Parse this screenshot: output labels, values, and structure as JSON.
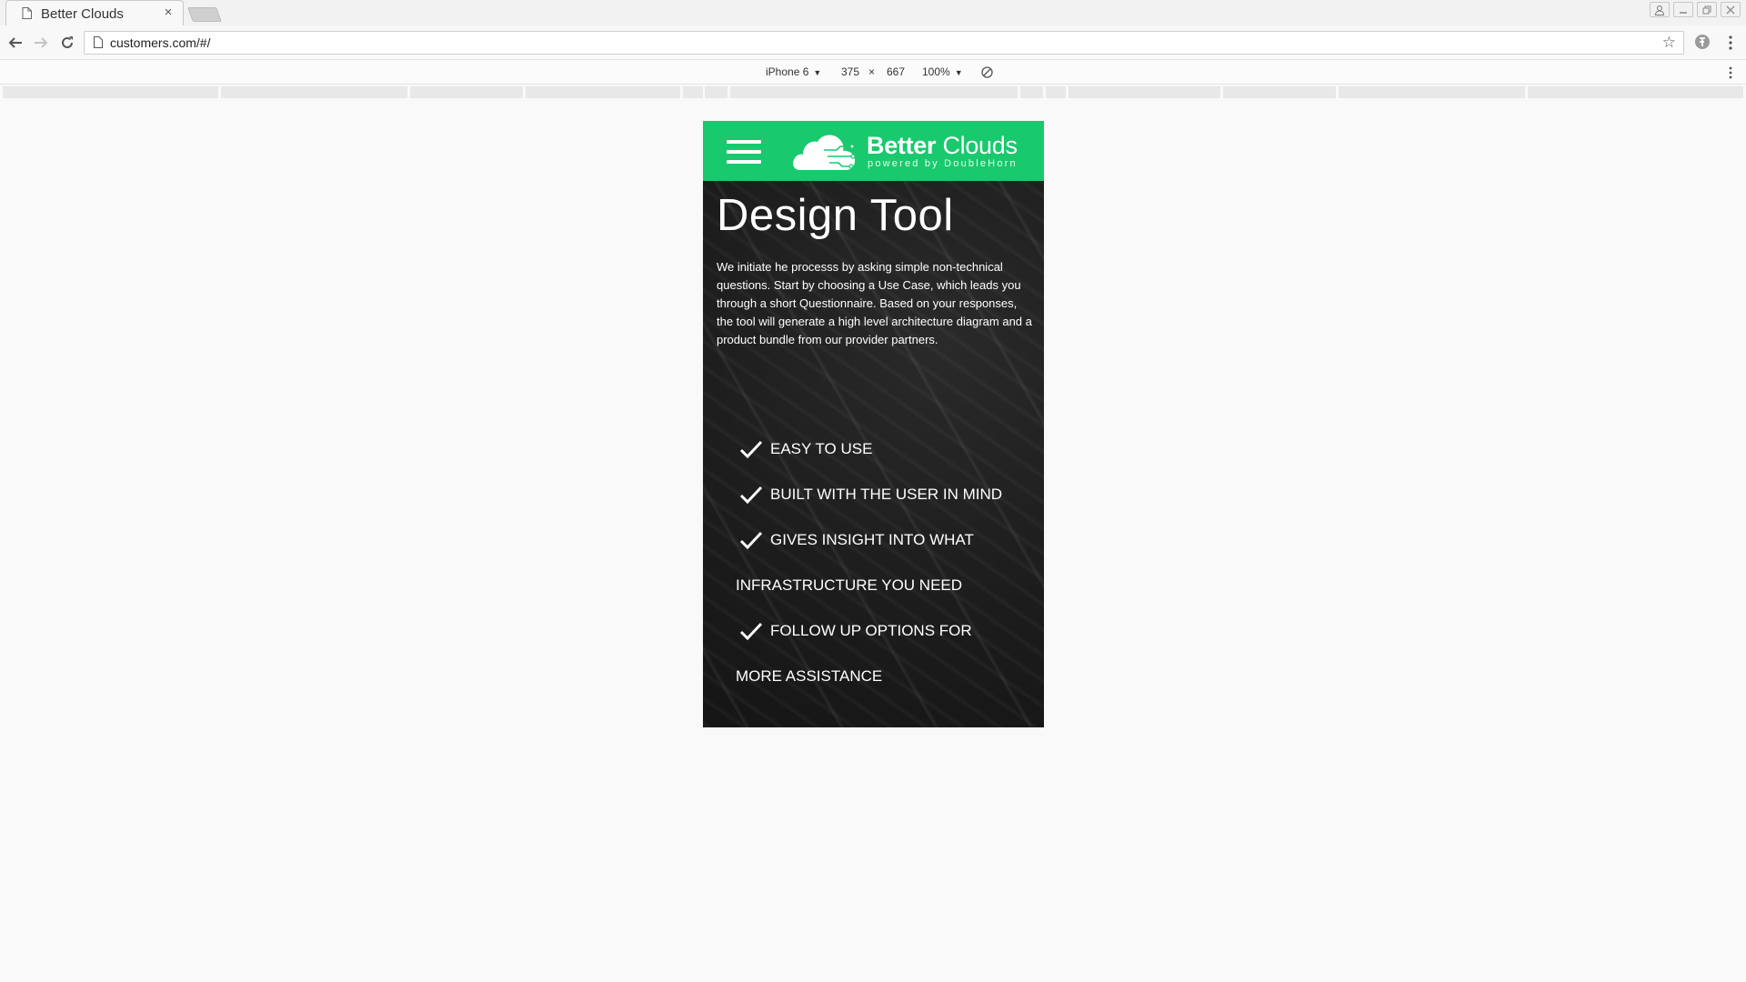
{
  "browser": {
    "tab_title": "Better Clouds",
    "tab_close": "×",
    "url": "customers.com/#/",
    "bookmark_icon": "star-icon",
    "window_controls": [
      "profile-icon",
      "minimize-icon",
      "restore-icon",
      "close-icon"
    ]
  },
  "device_toolbar": {
    "device": "iPhone 6",
    "width": "375",
    "times": "×",
    "height": "667",
    "zoom": "100%"
  },
  "app": {
    "brand_bold": "Better",
    "brand_light": "Clouds",
    "tagline": "powered by DoubleHorn",
    "accent_color": "#19c96d",
    "hero": {
      "title": "Design Tool",
      "description_lines": [
        "We initiate he processs by asking simple non-technical questions. Start by choosing a Use Case, which leads you",
        "through a short Questionnaire. Based on your responses,",
        "the tool will generate a high level architecture diagram and a product bundle from our provider partners."
      ]
    },
    "features": [
      {
        "text": "EASY TO USE",
        "cont": ""
      },
      {
        "text": "BUILT WITH THE USER IN MIND",
        "cont": ""
      },
      {
        "text": "GIVES INSIGHT INTO WHAT",
        "cont": "INFRASTRUCTURE YOU NEED"
      },
      {
        "text": "FOLLOW UP OPTIONS FOR",
        "cont": "MORE ASSISTANCE"
      }
    ]
  }
}
